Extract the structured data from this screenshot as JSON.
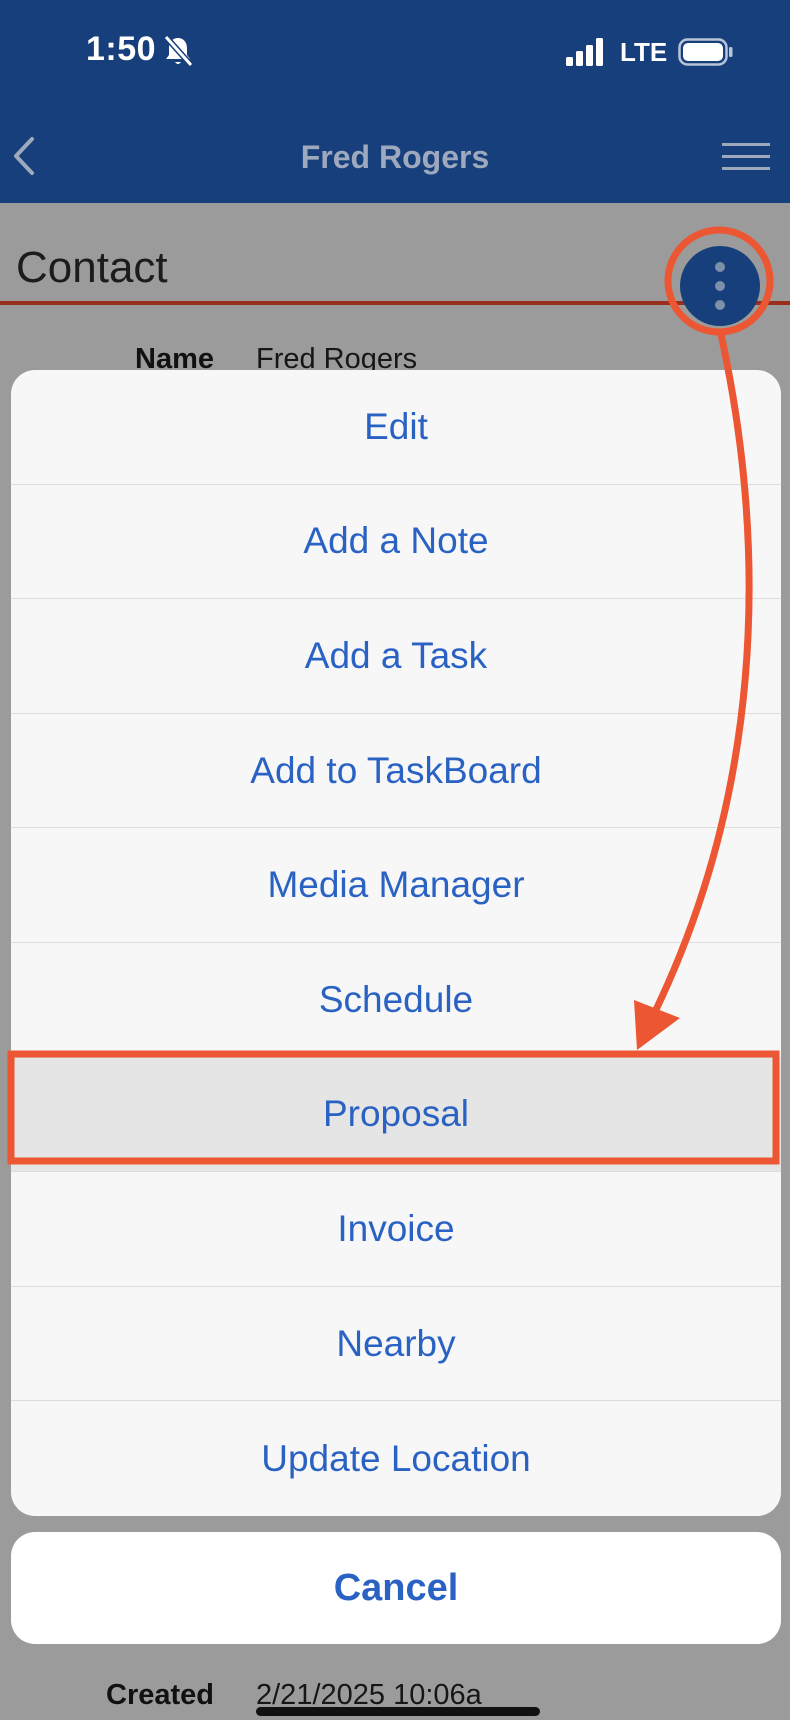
{
  "status_bar": {
    "time": "1:50",
    "network": "LTE"
  },
  "navbar": {
    "title": "Fred Rogers"
  },
  "section": {
    "title": "Contact"
  },
  "fields": {
    "name_label": "Name",
    "name_value": "Fred Rogers",
    "created_label": "Created",
    "created_value": "2/21/2025 10:06a"
  },
  "action_sheet": {
    "items": [
      {
        "label": "Edit"
      },
      {
        "label": "Add a Note"
      },
      {
        "label": "Add a Task"
      },
      {
        "label": "Add to TaskBoard"
      },
      {
        "label": "Media Manager"
      },
      {
        "label": "Schedule"
      },
      {
        "label": "Proposal"
      },
      {
        "label": "Invoice"
      },
      {
        "label": "Nearby"
      },
      {
        "label": "Update Location"
      }
    ],
    "cancel_label": "Cancel"
  },
  "colors": {
    "nav_blue": "#173f7c",
    "action_blue": "#2a62c4",
    "annotation_orange": "#ec5633",
    "section_rule": "#9a2e1d"
  },
  "icons": {
    "back": "back-chevron-icon",
    "menu": "hamburger-menu-icon",
    "more": "more-vertical-icon",
    "bell": "bell-muted-icon",
    "signal": "signal-bars-icon",
    "battery": "battery-icon"
  }
}
